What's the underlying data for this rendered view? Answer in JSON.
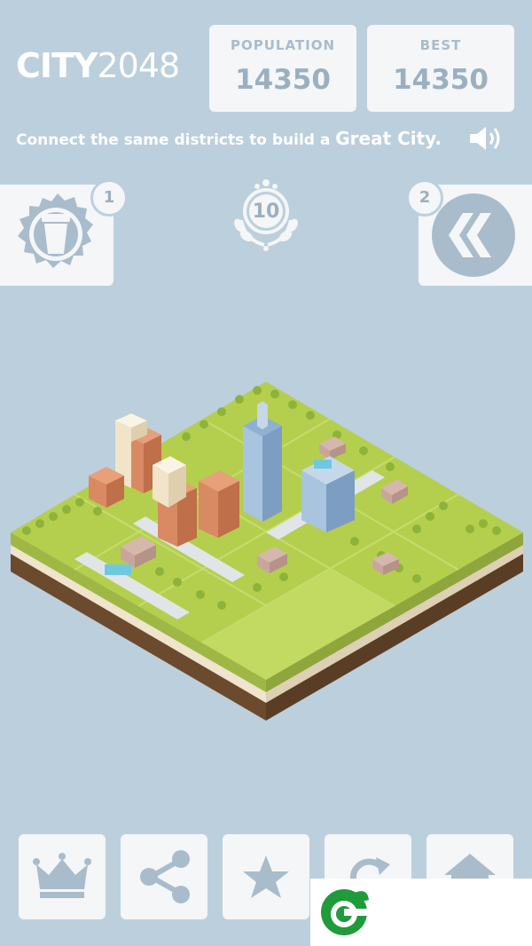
{
  "header": {
    "logo_bold": "CITY",
    "logo_light": "2048",
    "population": {
      "label": "POPULATION",
      "value": "14350"
    },
    "best": {
      "label": "BEST",
      "value": "14350"
    }
  },
  "tagline": {
    "text": "Connect the same districts to build a ",
    "emphasis": "Great City."
  },
  "icons": {
    "sound": "speaker-icon",
    "left_power": "cup-icon",
    "right_power": "undo-arrows-icon",
    "level_laurel": "laurel-icon"
  },
  "powerups": {
    "left_count": "1",
    "right_count": "2"
  },
  "level": {
    "value": "10"
  },
  "toolbar": [
    {
      "name": "crown-icon"
    },
    {
      "name": "share-icon"
    },
    {
      "name": "star-icon"
    },
    {
      "name": "restart-icon"
    },
    {
      "name": "home-icon"
    }
  ],
  "colors": {
    "background": "#bccfdc",
    "panel": "#f4f6f7",
    "accent": "#9bb0bf",
    "grass": "#b4cf4e",
    "soil": "#6b4a2e"
  }
}
